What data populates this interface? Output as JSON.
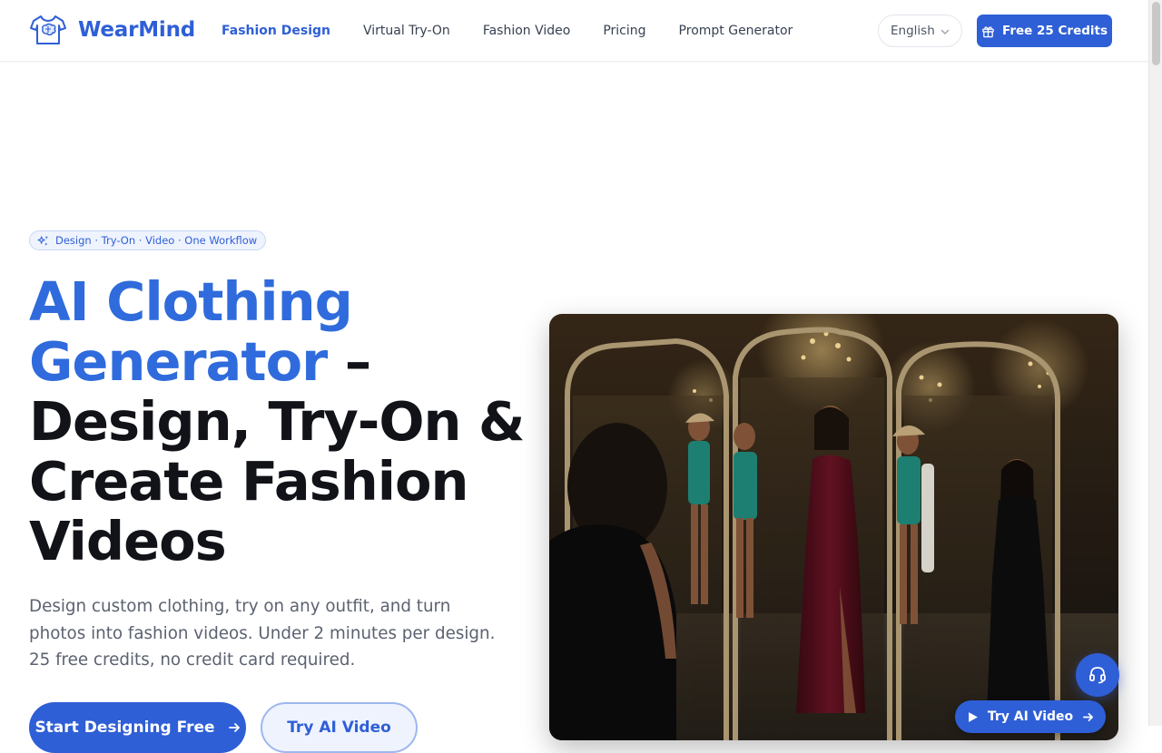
{
  "brand": {
    "name": "WearMind",
    "logo_icon": "tshirt-brain-icon",
    "accent": "#2f5fd6"
  },
  "nav": {
    "items": [
      {
        "label": "Fashion Design",
        "active": true
      },
      {
        "label": "Virtual Try-On",
        "active": false
      },
      {
        "label": "Fashion Video",
        "active": false
      },
      {
        "label": "Pricing",
        "active": false
      },
      {
        "label": "Prompt Generator",
        "active": false
      }
    ]
  },
  "language": {
    "selected": "English"
  },
  "header_cta": {
    "label": "Free 25 Credits",
    "icon": "gift-icon"
  },
  "hero": {
    "badge": "Design · Try-On · Video · One Workflow",
    "title_accent": "AI Clothing Generator",
    "title_rest": "– Design, Try-On & Create Fashion Videos",
    "description": "Design custom clothing, try on any outfit, and turn photos into fashion videos. Under 2 minutes per design. 25 free credits, no credit card required.",
    "primary_cta": "Start Designing Free",
    "secondary_cta": "Try AI Video",
    "image_alt": "Women in evening dresses in a mirrored hall with chandeliers",
    "video_cta": "Try AI Video"
  },
  "support": {
    "icon": "headset-icon"
  }
}
